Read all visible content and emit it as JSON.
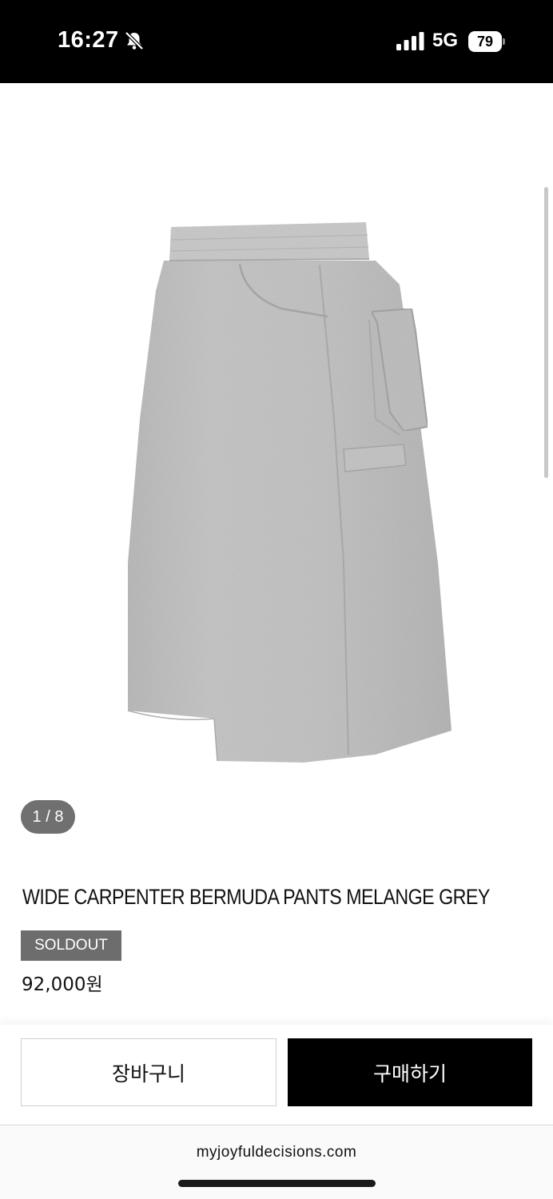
{
  "status_bar": {
    "time": "16:27",
    "network": "5G",
    "battery": "79",
    "icons": [
      "bell-slash-icon",
      "cellular-signal-icon",
      "battery-icon"
    ]
  },
  "gallery": {
    "image_alt": "Melange grey wide carpenter bermuda pants",
    "page_indicator": "1 / 8"
  },
  "product": {
    "title": "WIDE CARPENTER BERMUDA PANTS MELANGE GREY",
    "badge": "SOLDOUT",
    "price": "92,000원"
  },
  "actions": {
    "cart_label": "장바구니",
    "buy_label": "구매하기"
  },
  "browser": {
    "url": "myjoyfuldecisions.com"
  },
  "colors": {
    "status_bar_bg": "#000000",
    "badge_bg": "#6d6d6d",
    "buy_button_bg": "#000000",
    "fabric": "#c4c4c4"
  }
}
